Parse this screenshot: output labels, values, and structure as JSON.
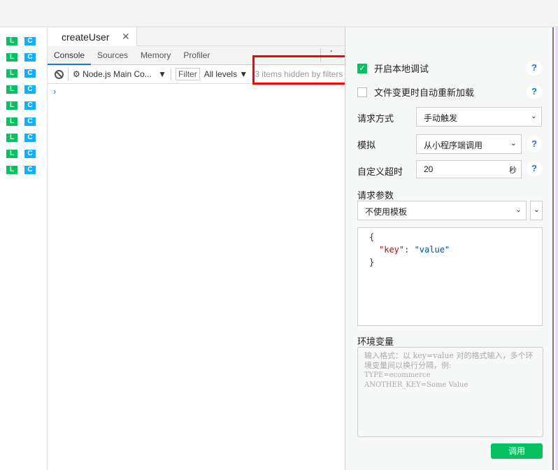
{
  "sidebar": {
    "badges": [
      {
        "l": "L",
        "c": "C"
      },
      {
        "l": "L",
        "c": "C"
      },
      {
        "l": "L",
        "c": "C"
      },
      {
        "l": "L",
        "c": "C"
      },
      {
        "l": "L",
        "c": "C"
      },
      {
        "l": "L",
        "c": "C"
      },
      {
        "l": "L",
        "c": "C"
      },
      {
        "l": "L",
        "c": "C"
      },
      {
        "l": "L",
        "c": "C"
      }
    ]
  },
  "file_tab": {
    "label": "createUser",
    "close": "✕"
  },
  "devtools": {
    "tabs": [
      "Console",
      "Sources",
      "Memory",
      "Profiler"
    ],
    "context": "Node.js Main Co...",
    "filter": "Filter",
    "levels": "All levels",
    "hidden_notice": "3 items hidden by filters",
    "prompt": "›"
  },
  "panel": {
    "local_debug": "开启本地调试",
    "auto_reload": "文件变更时自动重新加载",
    "request_mode_label": "请求方式",
    "request_mode": "手动触发",
    "simulate_label": "模拟",
    "simulate": "从小程序端调用",
    "timeout_label": "自定义超时",
    "timeout": "20",
    "timeout_unit": "秒",
    "params_label": "请求参数",
    "template": "不使用模板",
    "json": {
      "open": "{",
      "key": "\"key\"",
      "colon": ": ",
      "value": "\"value\"",
      "close": "}"
    },
    "env_label": "环境变量",
    "env_placeholder_1": "输入格式：以 key=value 对的格式输入，多个环境变量间以换行分隔，例:",
    "env_placeholder_2": "TYPE=ecommerce",
    "env_placeholder_3": "ANOTHER_KEY=Some Value",
    "call_button": "调用",
    "help": "?"
  },
  "colors": {
    "green": "#07c160",
    "blue": "#10aeff",
    "highlight": "#ff0000"
  }
}
